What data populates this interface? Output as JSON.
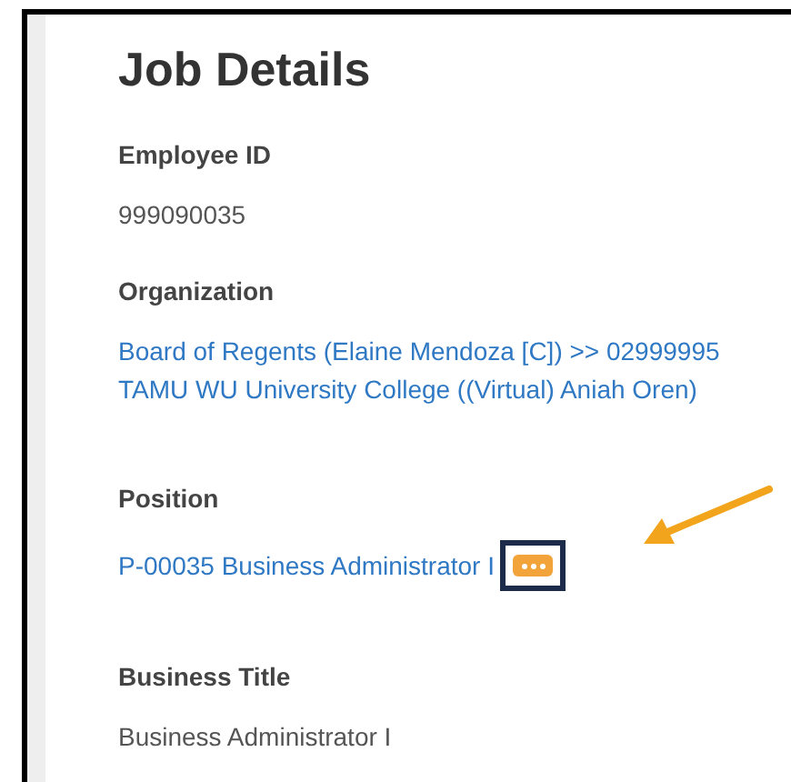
{
  "title": "Job Details",
  "fields": [
    {
      "label": "Employee ID",
      "kind": "text",
      "lines": [
        "999090035"
      ]
    },
    {
      "label": "Organization",
      "kind": "link",
      "lines": [
        "Board of Regents (Elaine Mendoza [C]) >> 02999995",
        "TAMU WU University College ((Virtual) Aniah Oren)"
      ]
    },
    {
      "label": "Position",
      "kind": "link",
      "lines": [
        "P-00035 Business Administrator I"
      ],
      "actions": true
    },
    {
      "label": "Business Title",
      "kind": "text",
      "lines": [
        "Business Administrator I"
      ]
    }
  ]
}
